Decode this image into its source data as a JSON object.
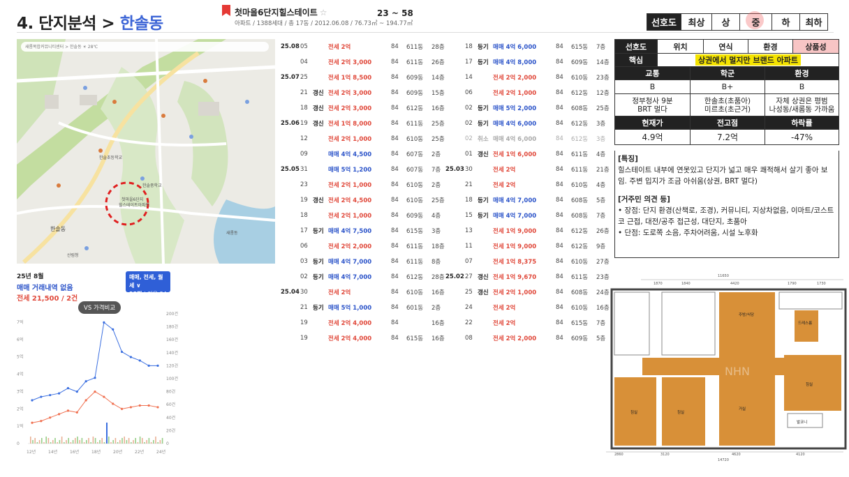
{
  "header": {
    "title_prefix": "4. 단지분석 > ",
    "title_highlight": "한솔동",
    "apartment_name": "첫마을6단지힐스테이트",
    "star": "☆",
    "apartment_info": "아파트 / 1388세대 / 총 17동 / 2012.06.08 / 76.73㎡ ~ 194.77㎡",
    "pyeong_range": "23 ~ 58",
    "grade_label": "선호도",
    "grades": [
      "최상",
      "상",
      "중",
      "하",
      "최하"
    ],
    "selected_grade": "중"
  },
  "map": {
    "search_text": "새롬복합커뮤니티센터  >  한솔동  ☀ 28℃",
    "labels": [
      "한솔동",
      "한솔중학교",
      "한솔초등학교",
      "첫마을6단지 힐스테이트아파트",
      "새롬동",
      "산림청"
    ]
  },
  "chart_panel": {
    "year_month": "25년 8월",
    "no_trade": "매매 거래내역 없음",
    "jeonse_summary": "전세 21,500 / 2건",
    "filter_line1": "매매, 전세, 월세 ∨",
    "filter_line2": "33평",
    "filter_line3": "전용 84㎡",
    "compare_button": "VS 가격비교"
  },
  "chart_data": {
    "type": "line",
    "x": [
      "12년",
      "14년",
      "16년",
      "18년",
      "20년",
      "22년",
      "24년"
    ],
    "y_left_ticks": [
      "7억",
      "6억",
      "5억",
      "4억",
      "3억",
      "2억",
      "1억",
      "0"
    ],
    "y_right_ticks": [
      "200건",
      "180건",
      "160건",
      "140건",
      "120건",
      "100건",
      "80건",
      "60건",
      "40건",
      "20건",
      "0"
    ],
    "series": [
      {
        "color": "#3b6fe0",
        "values": [
          2.5,
          2.7,
          2.8,
          2.9,
          3.2,
          3.0,
          3.6,
          3.8,
          7.0,
          6.6,
          5.3,
          5.0,
          4.8,
          4.5,
          4.5
        ]
      },
      {
        "color": "#f07050",
        "values": [
          1.2,
          1.3,
          1.5,
          1.7,
          1.9,
          1.8,
          2.5,
          3.0,
          2.7,
          2.3,
          2.0,
          2.1,
          2.2,
          2.2,
          2.1
        ]
      }
    ]
  },
  "tx_col1": [
    {
      "ym": "25.08",
      "d": "05",
      "tag": "",
      "price": "전세 2억",
      "kind": "red",
      "size": "84",
      "dong": "611동",
      "fl": "28층"
    },
    {
      "ym": "",
      "d": "04",
      "tag": "",
      "price": "전세 2억 3,000",
      "kind": "red",
      "size": "84",
      "dong": "611동",
      "fl": "26층"
    },
    {
      "ym": "25.07",
      "d": "25",
      "tag": "",
      "price": "전세 1억 8,500",
      "kind": "red",
      "size": "84",
      "dong": "609동",
      "fl": "14층"
    },
    {
      "ym": "",
      "d": "21",
      "tag": "갱신",
      "price": "전세 2억 3,000",
      "kind": "red",
      "size": "84",
      "dong": "609동",
      "fl": "15층"
    },
    {
      "ym": "",
      "d": "18",
      "tag": "갱신",
      "price": "전세 2억 3,000",
      "kind": "red",
      "size": "84",
      "dong": "612동",
      "fl": "16층"
    },
    {
      "ym": "25.06",
      "d": "19",
      "tag": "갱신",
      "price": "전세 1억 8,000",
      "kind": "red",
      "size": "84",
      "dong": "611동",
      "fl": "25층"
    },
    {
      "ym": "",
      "d": "12",
      "tag": "",
      "price": "전세 2억 1,000",
      "kind": "red",
      "size": "84",
      "dong": "610동",
      "fl": "25층"
    },
    {
      "ym": "",
      "d": "09",
      "tag": "",
      "price": "매매 4억 4,500",
      "kind": "blue",
      "size": "84",
      "dong": "607동",
      "fl": "2층"
    },
    {
      "ym": "25.05",
      "d": "31",
      "tag": "",
      "price": "매매 5억 1,200",
      "kind": "blue",
      "size": "84",
      "dong": "607동",
      "fl": "7층"
    },
    {
      "ym": "",
      "d": "23",
      "tag": "",
      "price": "전세 2억 1,000",
      "kind": "red",
      "size": "84",
      "dong": "610동",
      "fl": "2층"
    },
    {
      "ym": "",
      "d": "19",
      "tag": "갱신",
      "price": "전세 2억 4,500",
      "kind": "red",
      "size": "84",
      "dong": "610동",
      "fl": "25층"
    },
    {
      "ym": "",
      "d": "18",
      "tag": "",
      "price": "전세 2억 1,000",
      "kind": "red",
      "size": "84",
      "dong": "609동",
      "fl": "4층"
    },
    {
      "ym": "",
      "d": "17",
      "tag": "등기",
      "price": "매매 4억 7,500",
      "kind": "blue",
      "size": "84",
      "dong": "615동",
      "fl": "3층"
    },
    {
      "ym": "",
      "d": "06",
      "tag": "",
      "price": "전세 2억 2,000",
      "kind": "red",
      "size": "84",
      "dong": "611동",
      "fl": "18층"
    },
    {
      "ym": "",
      "d": "03",
      "tag": "등기",
      "price": "매매 4억 7,000",
      "kind": "blue",
      "size": "84",
      "dong": "611동",
      "fl": "8층"
    },
    {
      "ym": "",
      "d": "02",
      "tag": "등기",
      "price": "매매 4억 7,000",
      "kind": "blue",
      "size": "84",
      "dong": "612동",
      "fl": "28층"
    },
    {
      "ym": "25.04",
      "d": "30",
      "tag": "",
      "price": "전세 2억",
      "kind": "red",
      "size": "84",
      "dong": "610동",
      "fl": "16층"
    },
    {
      "ym": "",
      "d": "21",
      "tag": "등기",
      "price": "매매 5억 1,000",
      "kind": "blue",
      "size": "84",
      "dong": "601동",
      "fl": "2층"
    },
    {
      "ym": "",
      "d": "19",
      "tag": "",
      "price": "전세 2억 4,000",
      "kind": "red",
      "size": "84",
      "dong": "",
      "fl": "16층"
    },
    {
      "ym": "",
      "d": "19",
      "tag": "",
      "price": "전세 2억 4,000",
      "kind": "red",
      "size": "84",
      "dong": "615동",
      "fl": "16층"
    }
  ],
  "tx_col2": [
    {
      "ym": "",
      "d": "18",
      "tag": "등기",
      "price": "매매 4억 6,000",
      "kind": "blue",
      "size": "84",
      "dong": "615동",
      "fl": "7층"
    },
    {
      "ym": "",
      "d": "17",
      "tag": "등기",
      "price": "매매 4억 8,000",
      "kind": "blue",
      "size": "84",
      "dong": "609동",
      "fl": "14층"
    },
    {
      "ym": "",
      "d": "14",
      "tag": "",
      "price": "전세 2억 2,000",
      "kind": "red",
      "size": "84",
      "dong": "610동",
      "fl": "23층"
    },
    {
      "ym": "",
      "d": "06",
      "tag": "",
      "price": "전세 2억 1,000",
      "kind": "red",
      "size": "84",
      "dong": "612동",
      "fl": "12층"
    },
    {
      "ym": "",
      "d": "02",
      "tag": "등기",
      "price": "매매 5억 2,000",
      "kind": "blue",
      "size": "84",
      "dong": "608동",
      "fl": "25층"
    },
    {
      "ym": "",
      "d": "02",
      "tag": "등기",
      "price": "매매 4억 6,000",
      "kind": "blue",
      "size": "84",
      "dong": "612동",
      "fl": "3층"
    },
    {
      "ym": "",
      "d": "02",
      "tag": "취소",
      "price": "매매 4억 6,000",
      "kind": "gray",
      "size": "84",
      "dong": "612동",
      "fl": "3층"
    },
    {
      "ym": "",
      "d": "01",
      "tag": "갱신",
      "price": "전세 1억 6,000",
      "kind": "red",
      "size": "84",
      "dong": "611동",
      "fl": "4층"
    },
    {
      "ym": "25.03",
      "d": "30",
      "tag": "",
      "price": "전세 2억",
      "kind": "red",
      "size": "84",
      "dong": "611동",
      "fl": "21층"
    },
    {
      "ym": "",
      "d": "21",
      "tag": "",
      "price": "전세 2억",
      "kind": "red",
      "size": "84",
      "dong": "610동",
      "fl": "4층"
    },
    {
      "ym": "",
      "d": "18",
      "tag": "등기",
      "price": "매매 4억 7,000",
      "kind": "blue",
      "size": "84",
      "dong": "608동",
      "fl": "5층"
    },
    {
      "ym": "",
      "d": "15",
      "tag": "등기",
      "price": "매매 4억 7,000",
      "kind": "blue",
      "size": "84",
      "dong": "608동",
      "fl": "7층"
    },
    {
      "ym": "",
      "d": "13",
      "tag": "",
      "price": "전세 1억 9,000",
      "kind": "red",
      "size": "84",
      "dong": "612동",
      "fl": "26층"
    },
    {
      "ym": "",
      "d": "11",
      "tag": "",
      "price": "전세 1억 9,000",
      "kind": "red",
      "size": "84",
      "dong": "612동",
      "fl": "9층"
    },
    {
      "ym": "",
      "d": "07",
      "tag": "",
      "price": "전세 1억 8,375",
      "kind": "red",
      "size": "84",
      "dong": "610동",
      "fl": "27층"
    },
    {
      "ym": "25.02",
      "d": "27",
      "tag": "갱신",
      "price": "전세 1억 9,670",
      "kind": "red",
      "size": "84",
      "dong": "611동",
      "fl": "23층"
    },
    {
      "ym": "",
      "d": "25",
      "tag": "갱신",
      "price": "전세 2억 1,000",
      "kind": "red",
      "size": "84",
      "dong": "608동",
      "fl": "24층"
    },
    {
      "ym": "",
      "d": "24",
      "tag": "",
      "price": "전세 2억",
      "kind": "red",
      "size": "84",
      "dong": "610동",
      "fl": "16층"
    },
    {
      "ym": "",
      "d": "22",
      "tag": "",
      "price": "전세 2억",
      "kind": "red",
      "size": "84",
      "dong": "615동",
      "fl": "7층"
    },
    {
      "ym": "",
      "d": "08",
      "tag": "",
      "price": "전세 2억 2,000",
      "kind": "red",
      "size": "84",
      "dong": "609동",
      "fl": "5층"
    }
  ],
  "analysis": {
    "headers": [
      "선호도",
      "위치",
      "연식",
      "환경",
      "상품성"
    ],
    "core_label": "핵심",
    "core_value": "상권에서 멀지만 브랜드 아파트",
    "sub_headers": [
      "교통",
      "학군",
      "환경"
    ],
    "grades": [
      "B",
      "B+",
      "B"
    ],
    "details": [
      "정부청사 9분\nBRT 멀다",
      "한솔초(초품아)\n미르초(초근거)",
      "자체 상권은 평범\n나성동/새롬동 가까움"
    ],
    "price_headers": [
      "현재가",
      "전고점",
      "하락률"
    ],
    "prices": [
      "4.9억",
      "7.2억",
      "-47%"
    ]
  },
  "feature": {
    "title": "[특징]",
    "text": "힐스테이트 내부에 연못있고 단지가 넓고 매우 쾌적해서 살기 좋아 보임. 주변 입지가 조금 아쉬움(상권, BRT 멀다)",
    "opinion_title": "[거주민 의견 등]",
    "pros": "• 장점: 단지 환경(산책로, 조경), 커뮤니티, 지상차없음, 이마트/코스트코 근접, 대전/공주 접근성, 대단지, 초품아",
    "cons": "• 단점: 도로쪽 소음, 주차어려움, 시설 노후화"
  },
  "floorplan": {
    "dims_top": [
      "11650",
      "1870",
      "1840",
      "4420",
      "1790",
      "1730"
    ],
    "dims_bottom": [
      "2860",
      "3120",
      "4620",
      "4120"
    ],
    "total_bottom": "14720",
    "dims_left": [
      "2580",
      "1840",
      "1380",
      "4160",
      "850"
    ],
    "dims_right": [
      "1500",
      "2820",
      "3520",
      "1500"
    ],
    "rooms": [
      "주방/식당",
      "드레스룸",
      "침실",
      "침실",
      "거실",
      "침실",
      "발코니"
    ],
    "watermark": "NHN"
  }
}
